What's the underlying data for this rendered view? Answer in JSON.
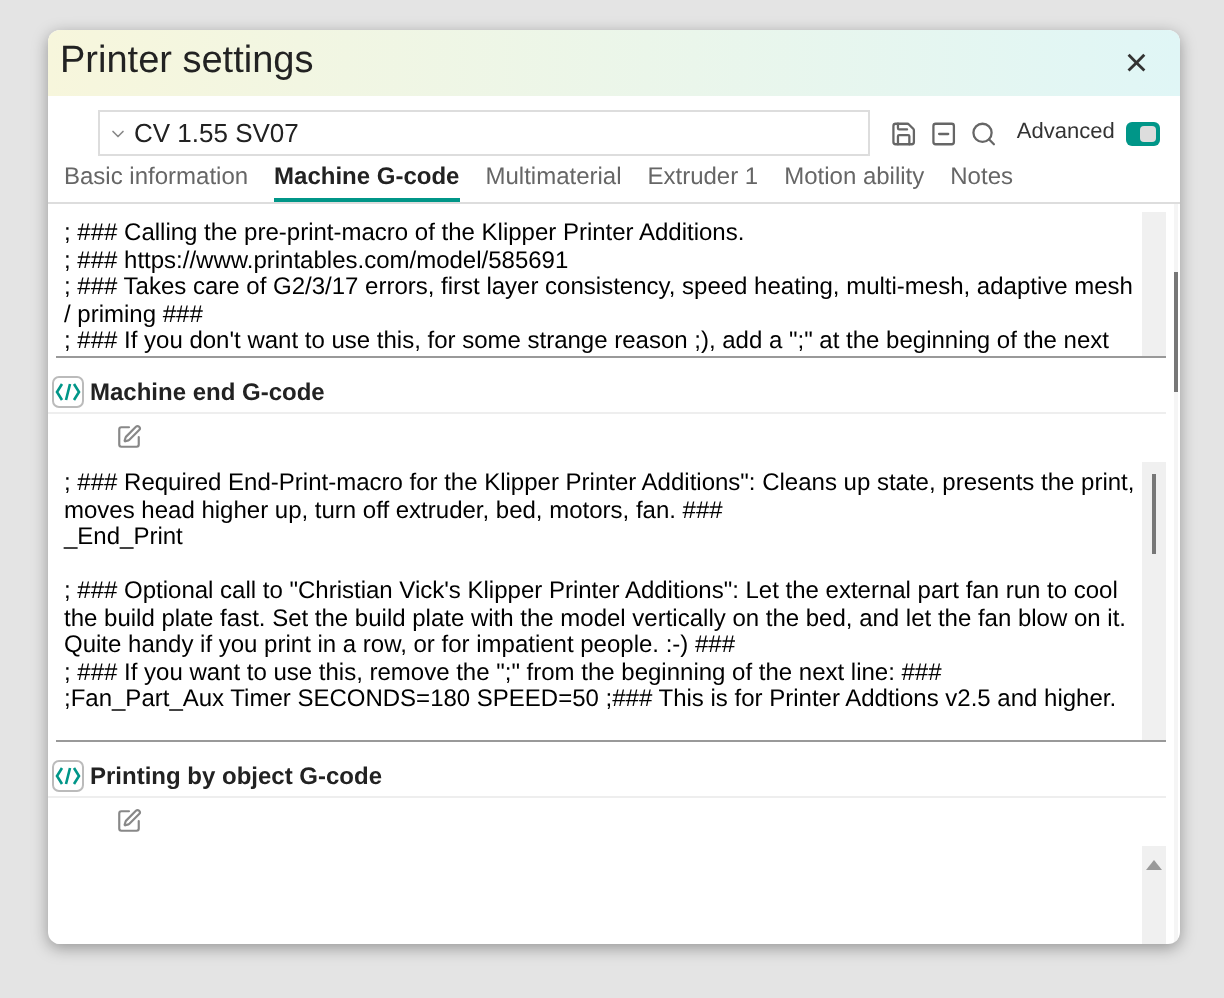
{
  "window": {
    "title": "Printer settings",
    "close": "×"
  },
  "preset": {
    "value": "CV 1.55 SV07",
    "advanced_label": "Advanced",
    "advanced_on": true
  },
  "tabs": [
    {
      "label": "Basic information",
      "selected": false
    },
    {
      "label": "Machine G-code",
      "selected": true
    },
    {
      "label": "Multimaterial",
      "selected": false
    },
    {
      "label": "Extruder 1",
      "selected": false
    },
    {
      "label": "Motion ability",
      "selected": false
    },
    {
      "label": "Notes",
      "selected": false
    }
  ],
  "sections": [
    {
      "paragraphs": [
        [
          "; ### Calling the pre-print-macro of the Klipper Printer Additions.",
          "; ### https://www.printables.com/model/585691",
          "; ### Takes care of G2/3/17 errors, first layer consistency, speed heating, multi-mesh, adaptive mesh",
          "/ priming ###",
          "; ### If you don't want to use this, for some strange reason ;), add a \";\" at the beginning of the next"
        ]
      ]
    },
    {
      "title": "Machine end G-code",
      "paragraphs": [
        [
          "; ### Required End-Print-macro for the Klipper Printer Additions\": Cleans up state, presents the print,",
          "moves head higher up, turn off extruder, bed, motors, fan. ###",
          "_End_Print"
        ],
        [
          "; ### Optional call to \"Christian Vick's Klipper Printer Additions\": Let the external part fan run to cool",
          "the build plate fast. Set the build plate with the model vertically on the bed, and let the fan blow on it.",
          "Quite handy if you print in a row, or for impatient people. :-) ###",
          "; ### If you want to use this, remove the \";\" from the beginning of the next line: ###",
          ";Fan_Part_Aux Timer SECONDS=180 SPEED=50 ;### This is for Printer Addtions v2.5 and higher."
        ]
      ]
    },
    {
      "title": "Printing by object G-code"
    }
  ]
}
